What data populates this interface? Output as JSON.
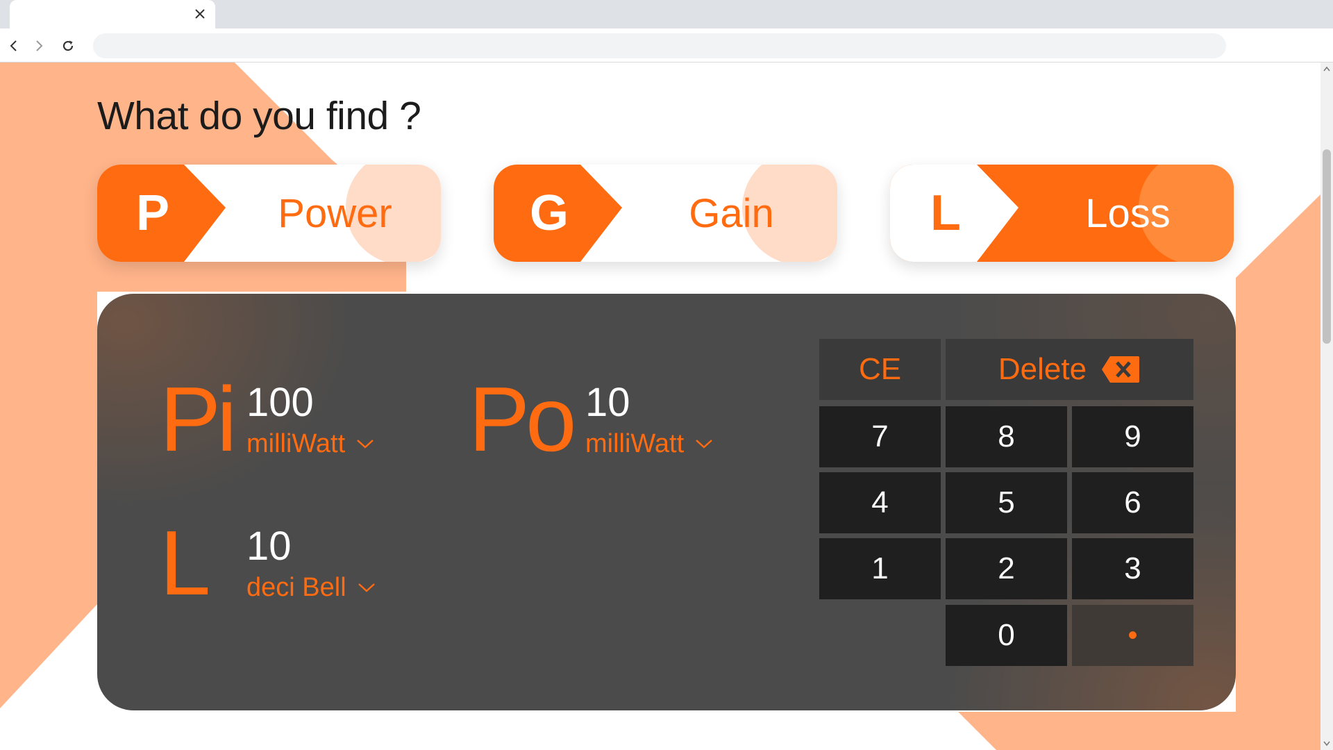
{
  "browser": {
    "tab_close_icon": "close-icon",
    "back_icon": "chevron-left-icon",
    "forward_icon": "chevron-right-icon",
    "reload_icon": "reload-icon",
    "address": ""
  },
  "page": {
    "heading": "What do you find ?",
    "modes": [
      {
        "letter": "P",
        "label": "Power",
        "selected": false
      },
      {
        "letter": "G",
        "label": "Gain",
        "selected": false
      },
      {
        "letter": "L",
        "label": "Loss",
        "selected": true
      }
    ],
    "variables": {
      "pi": {
        "symbol": "Pi",
        "value": "100",
        "unit": "milliWatt"
      },
      "po": {
        "symbol": "Po",
        "value": "10",
        "unit": "milliWatt"
      },
      "l": {
        "symbol": "L",
        "value": "10",
        "unit": "deci Bell"
      }
    },
    "keypad": {
      "ce": "CE",
      "delete": "Delete",
      "delete_icon": "backspace-icon",
      "k7": "7",
      "k8": "8",
      "k9": "9",
      "k4": "4",
      "k5": "5",
      "k6": "6",
      "k1": "1",
      "k2": "2",
      "k3": "3",
      "k0": "0",
      "dot": "•"
    }
  },
  "colors": {
    "accent": "#ff6b10",
    "accent_light": "#ffd9c2",
    "background_peach": "#ffb48a",
    "panel": "#4b4b4b",
    "key": "#1f1f1f",
    "key_top": "#3a3a3a"
  }
}
